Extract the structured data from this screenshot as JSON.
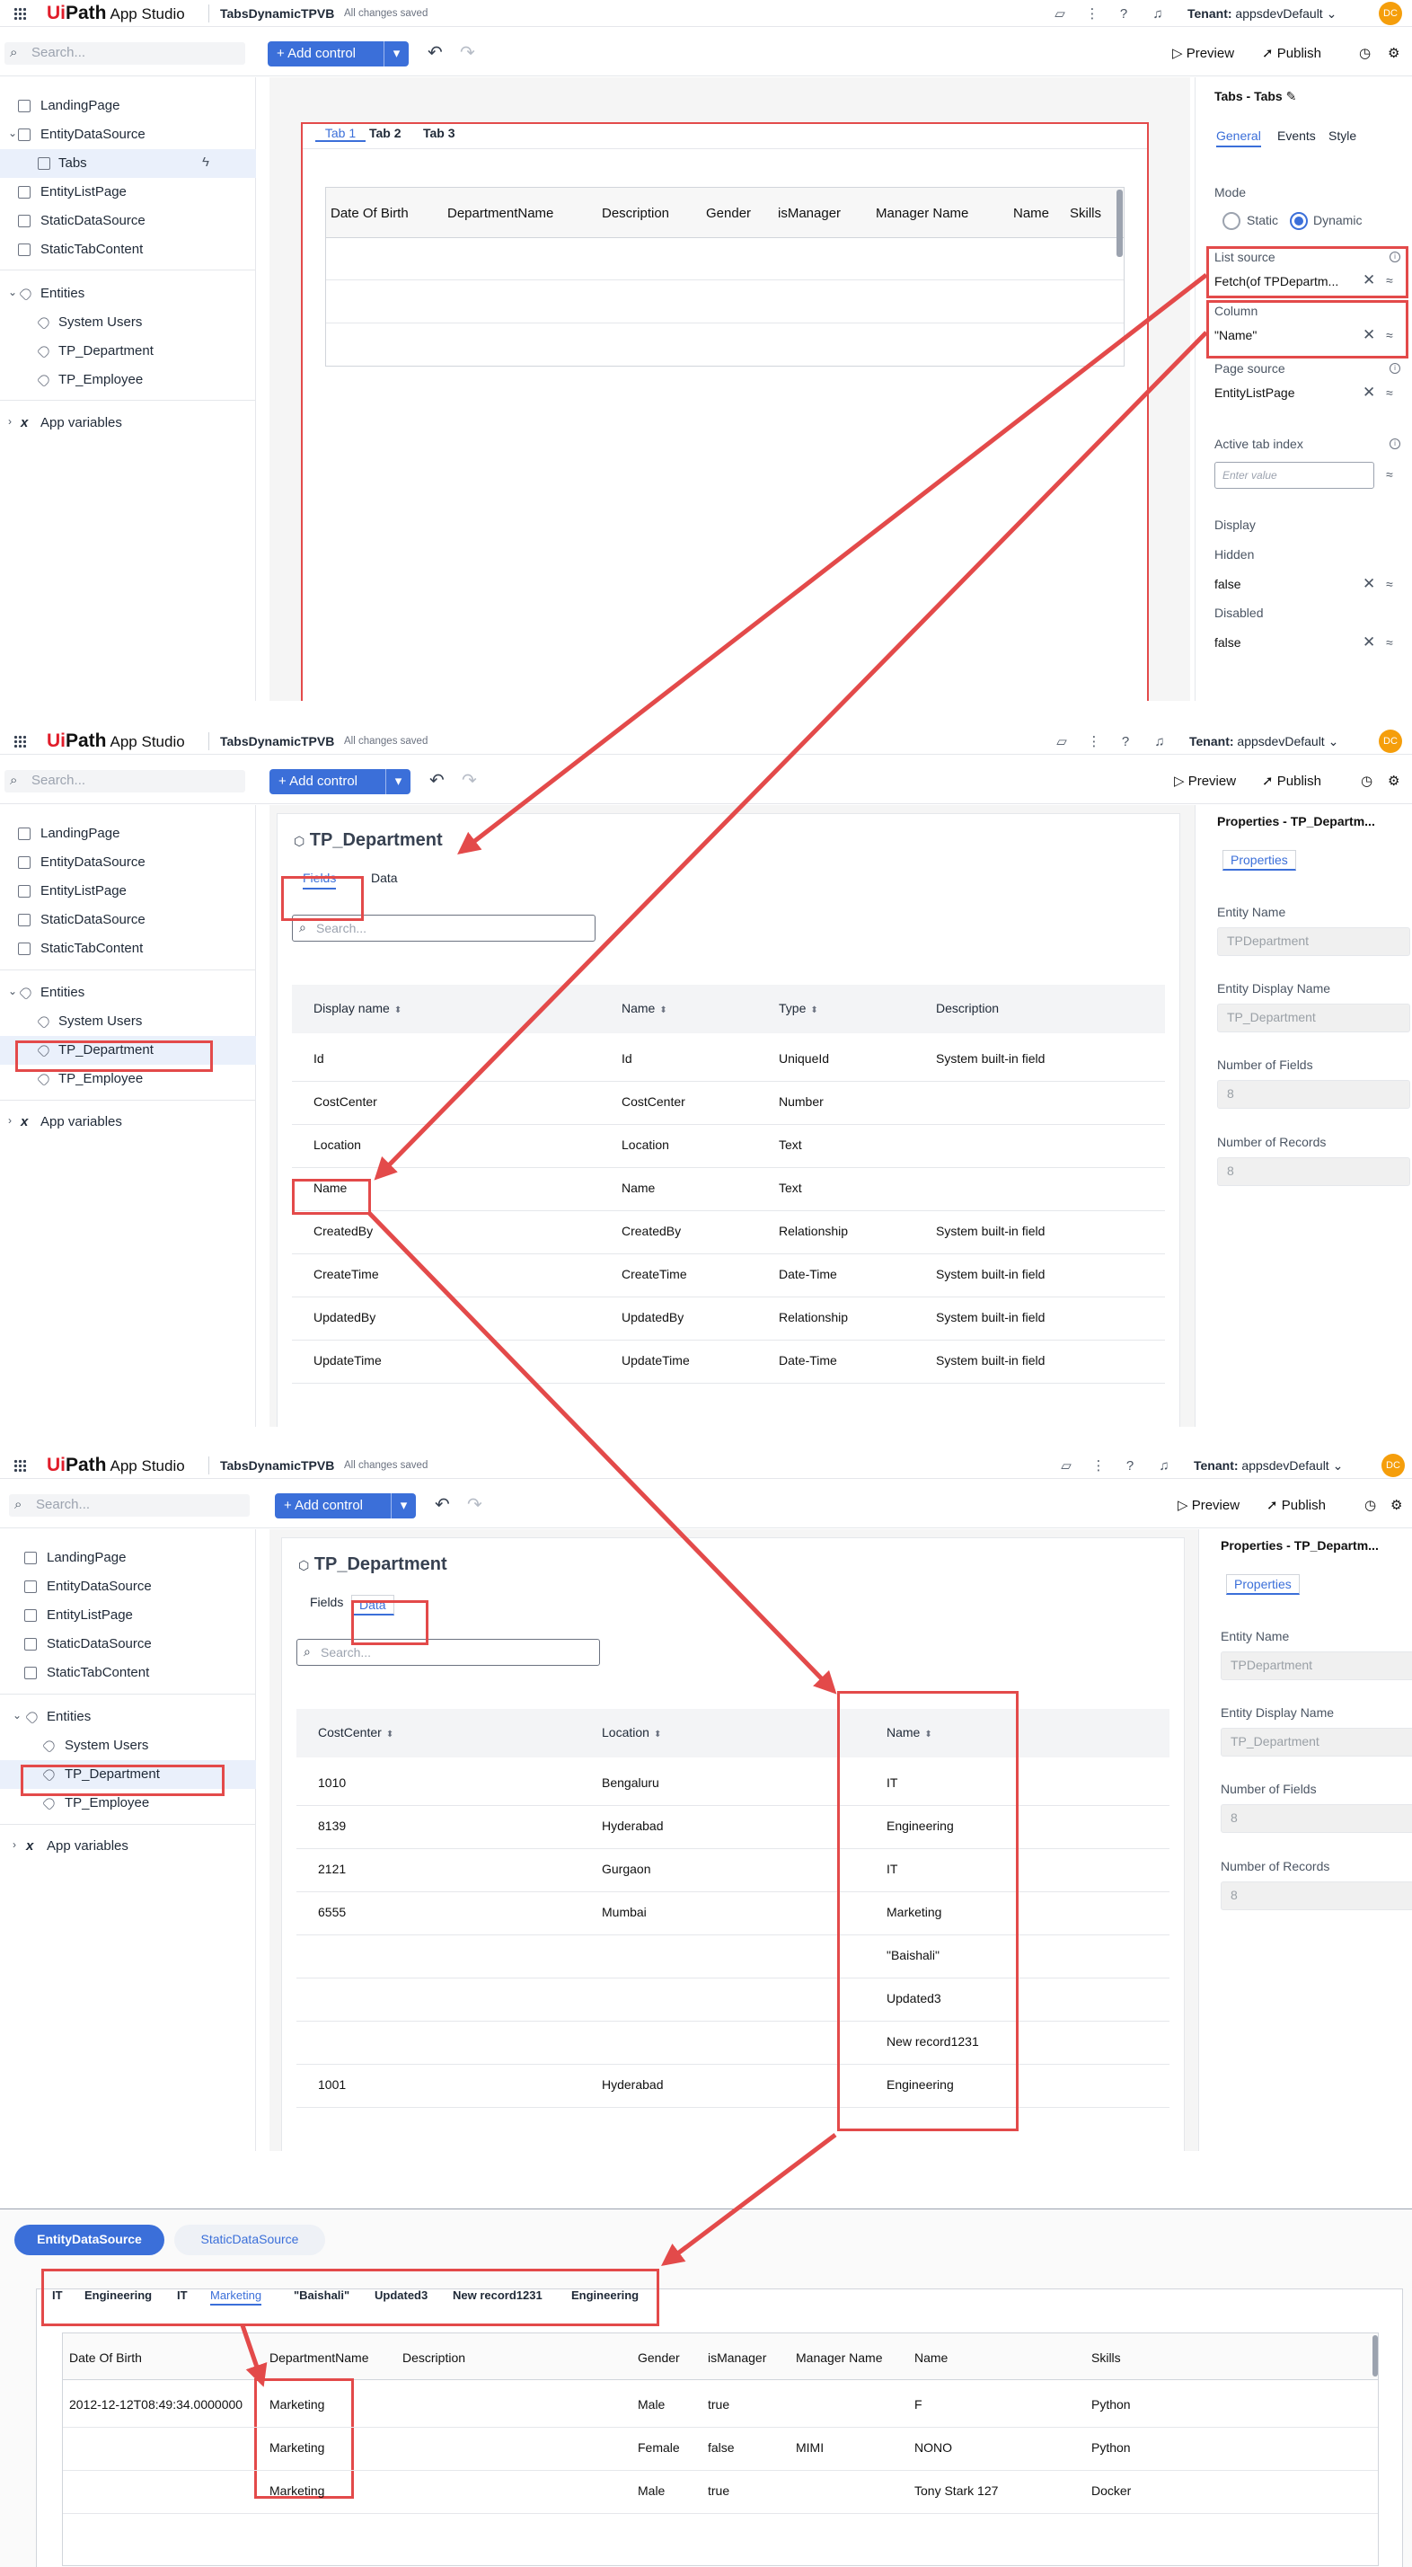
{
  "app": {
    "logo_prefix": "Ui",
    "logo_suffix": "Path",
    "logo_app": "App Studio",
    "project": "TabsDynamicTPVB",
    "save_status": "All changes saved",
    "tenant_label": "Tenant:",
    "tenant_value": "appsdevDefault",
    "avatar": "DC"
  },
  "toolbar": {
    "search_placeholder": "Search...",
    "add_control": "Add control",
    "preview": "Preview",
    "publish": "Publish"
  },
  "sidebar": {
    "pages": [
      "LandingPage",
      "EntityDataSource",
      "EntityListPage",
      "StaticDataSource",
      "StaticTabContent"
    ],
    "tabs_child": "Tabs",
    "entities_header": "Entities",
    "entities": [
      "System Users",
      "TP_Department",
      "TP_Employee"
    ],
    "app_variables": "App variables"
  },
  "panel1": {
    "tabs": [
      "Tab 1",
      "Tab 2",
      "Tab 3"
    ],
    "grid_columns": [
      "Date Of Birth",
      "DepartmentName",
      "Description",
      "Gender",
      "isManager",
      "Manager Name",
      "Name",
      "Skills"
    ],
    "props": {
      "title": "Tabs - Tabs",
      "tabs": [
        "General",
        "Events",
        "Style"
      ],
      "mode_label": "Mode",
      "mode_static": "Static",
      "mode_dynamic": "Dynamic",
      "list_source_label": "List source",
      "list_source_value": "Fetch(of TPDepartm...",
      "column_label": "Column",
      "column_value": "\"Name\"",
      "page_source_label": "Page source",
      "page_source_value": "EntityListPage",
      "active_tab_label": "Active tab index",
      "active_tab_placeholder": "Enter value",
      "display_label": "Display",
      "hidden_label": "Hidden",
      "hidden_value": "false",
      "disabled_label": "Disabled",
      "disabled_value": "false"
    }
  },
  "entity": {
    "title": "TP_Department",
    "tab_fields": "Fields",
    "tab_data": "Data",
    "search_placeholder": "Search...",
    "props_title": "Properties - TP_Departm...",
    "props_tab": "Properties",
    "entity_name_label": "Entity Name",
    "entity_name_value": "TPDepartment",
    "display_name_label": "Entity Display Name",
    "display_name_value": "TP_Department",
    "num_fields_label": "Number of Fields",
    "num_fields_value": "8",
    "num_records_label": "Number of Records",
    "num_records_value": "8"
  },
  "fields_table": {
    "headers": [
      "Display name",
      "Name",
      "Type",
      "Description"
    ],
    "rows": [
      [
        "Id",
        "Id",
        "UniqueId",
        "System built-in field"
      ],
      [
        "CostCenter",
        "CostCenter",
        "Number",
        ""
      ],
      [
        "Location",
        "Location",
        "Text",
        ""
      ],
      [
        "Name",
        "Name",
        "Text",
        ""
      ],
      [
        "CreatedBy",
        "CreatedBy",
        "Relationship",
        "System built-in field"
      ],
      [
        "CreateTime",
        "CreateTime",
        "Date-Time",
        "System built-in field"
      ],
      [
        "UpdatedBy",
        "UpdatedBy",
        "Relationship",
        "System built-in field"
      ],
      [
        "UpdateTime",
        "UpdateTime",
        "Date-Time",
        "System built-in field"
      ]
    ]
  },
  "data_table": {
    "headers": [
      "CostCenter",
      "Location",
      "Name"
    ],
    "rows": [
      [
        "1010",
        "Bengaluru",
        "IT"
      ],
      [
        "8139",
        "Hyderabad",
        "Engineering"
      ],
      [
        "2121",
        "Gurgaon",
        "IT"
      ],
      [
        "6555",
        "Mumbai",
        "Marketing"
      ],
      [
        "",
        "",
        "\"Baishali\""
      ],
      [
        "",
        "",
        "Updated3"
      ],
      [
        "",
        "",
        "New record1231"
      ],
      [
        "1001",
        "Hyderabad",
        "Engineering"
      ]
    ]
  },
  "runtime": {
    "source_tabs": [
      "EntityDataSource",
      "StaticDataSource"
    ],
    "tabs": [
      "IT",
      "Engineering",
      "IT",
      "Marketing",
      "\"Baishali\"",
      "Updated3",
      "New record1231",
      "Engineering"
    ],
    "active_tab": 3,
    "grid_columns": [
      "Date Of Birth",
      "DepartmentName",
      "Description",
      "Gender",
      "isManager",
      "Manager Name",
      "Name",
      "Skills"
    ],
    "rows": [
      [
        "2012-12-12T08:49:34.0000000",
        "Marketing",
        "",
        "Male",
        "true",
        "",
        "F",
        "Python"
      ],
      [
        "",
        "Marketing",
        "",
        "Female",
        "false",
        "MIMI",
        "NONO",
        "Python"
      ],
      [
        "",
        "Marketing",
        "",
        "Male",
        "true",
        "",
        "Tony Stark 127",
        "Docker"
      ]
    ]
  },
  "colors": {
    "accent": "#3b6fd9",
    "annotation": "#e34a4a"
  }
}
